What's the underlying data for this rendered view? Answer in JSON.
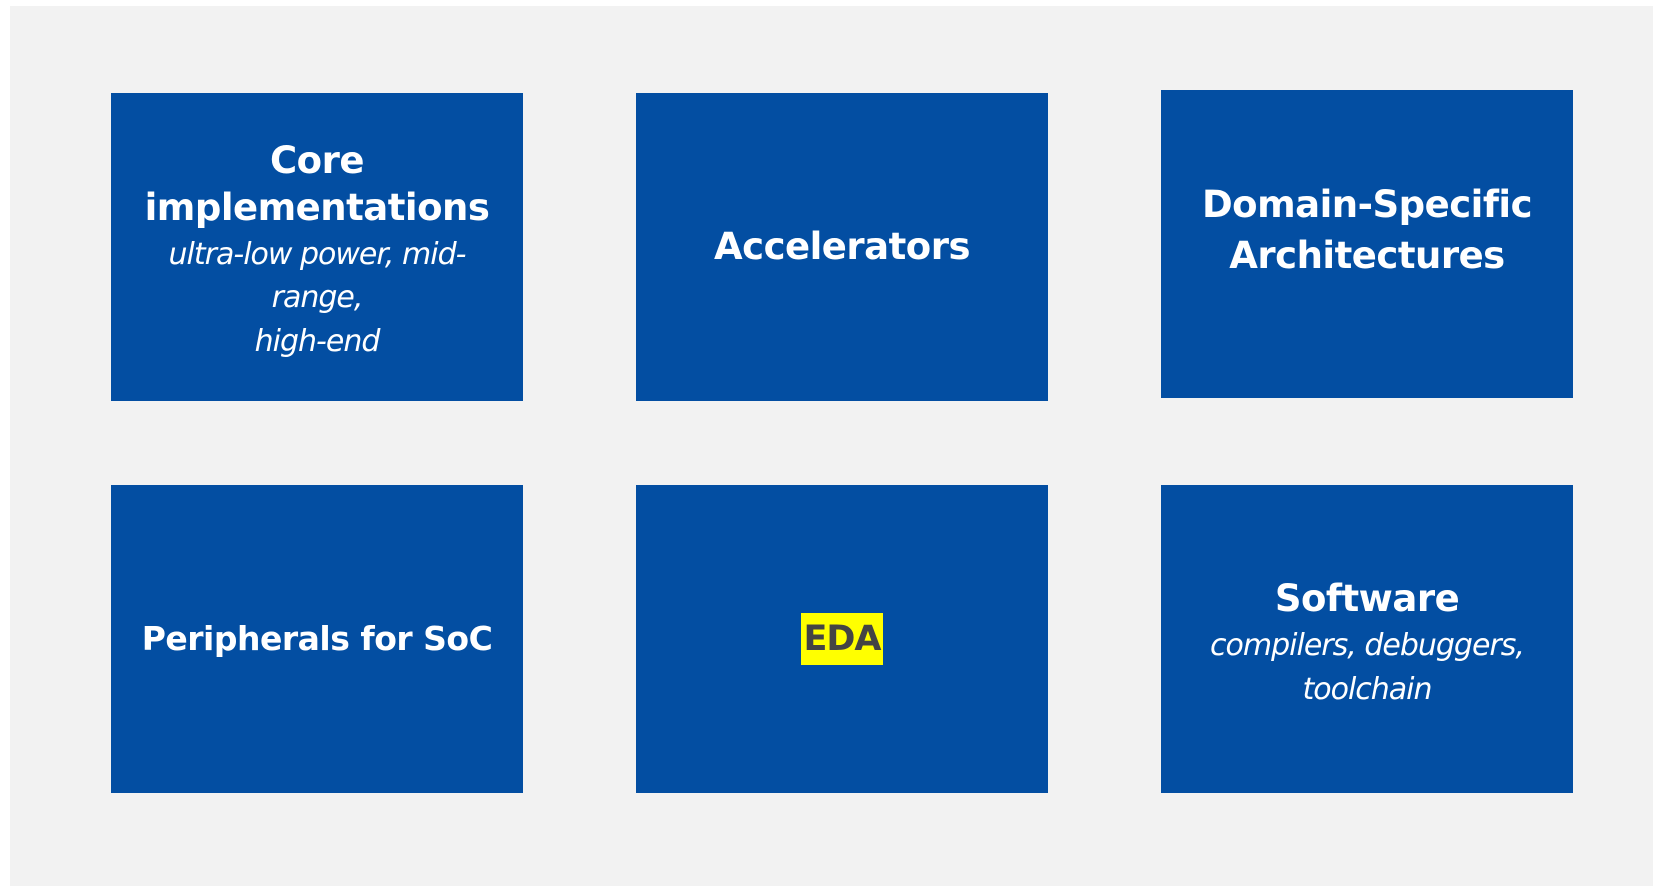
{
  "tiles": {
    "core": {
      "title_line1": "Core",
      "title_line2": "implementations",
      "subtitle_line1": "ultra-low power, mid-range,",
      "subtitle_line2": "high-end"
    },
    "accelerators": {
      "title": "Accelerators"
    },
    "dsa": {
      "title_line1": "Domain-Specific",
      "title_line2": "Architectures"
    },
    "peripherals": {
      "title": "Peripherals for SoC"
    },
    "eda": {
      "title": "EDA"
    },
    "software": {
      "title": "Software",
      "subtitle_line1": "compilers, debuggers,",
      "subtitle_line2": "toolchain"
    }
  },
  "colors": {
    "background": "#f2f2f2",
    "tile": "#034ea2",
    "tile_text": "#ffffff",
    "highlight": "#ffff00",
    "highlight_text": "#444444"
  }
}
